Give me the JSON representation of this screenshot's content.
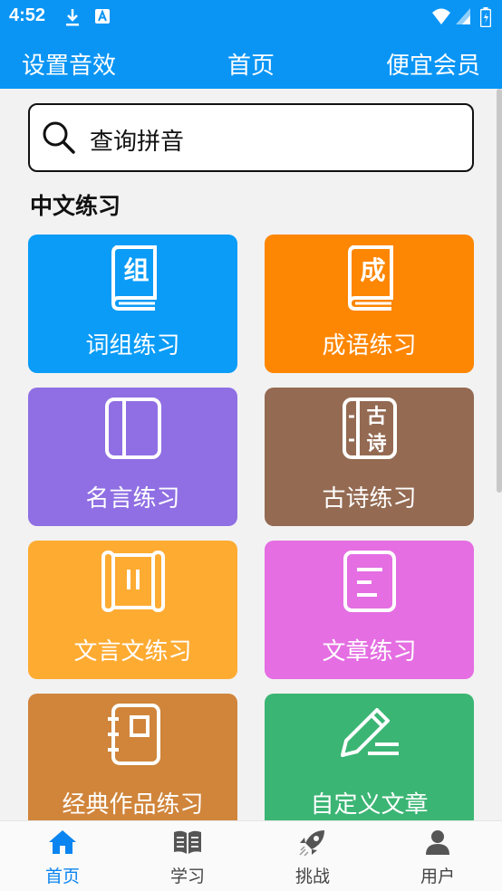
{
  "status_bar": {
    "time": "4:52",
    "icons": [
      "download-icon",
      "font-app-icon",
      "wifi-icon",
      "signal-icon",
      "battery-icon"
    ]
  },
  "app_bar": {
    "left_label": "设置音效",
    "title": "首页",
    "right_label": "便宜会员"
  },
  "search": {
    "placeholder": "查询拼音",
    "icon": "search-icon"
  },
  "section_title": "中文练习",
  "cards": [
    {
      "label": "词组练习",
      "glyph": "组",
      "icon": "book-icon",
      "color": "#0a9cf7"
    },
    {
      "label": "成语练习",
      "glyph": "成",
      "icon": "book-icon",
      "color": "#fd8602"
    },
    {
      "label": "名言练习",
      "glyph": "",
      "icon": "panel-book-icon",
      "color": "#8f6fe3"
    },
    {
      "label": "古诗练习",
      "glyph_top": "古",
      "glyph_bottom": "诗",
      "icon": "poem-book-icon",
      "color": "#946a52"
    },
    {
      "label": "文言文练习",
      "glyph": "",
      "icon": "scroll-icon",
      "color": "#feab32"
    },
    {
      "label": "文章练习",
      "glyph": "",
      "icon": "document-icon",
      "color": "#e46ee2"
    },
    {
      "label": "经典作品练习",
      "glyph": "",
      "icon": "notebook-icon",
      "color": "#d0853b"
    },
    {
      "label": "自定义文章",
      "glyph": "",
      "icon": "pencil-icon",
      "color": "#3bb574"
    }
  ],
  "bottom_nav": [
    {
      "label": "首页",
      "icon": "home-icon",
      "active": true
    },
    {
      "label": "学习",
      "icon": "open-book-icon",
      "active": false
    },
    {
      "label": "挑战",
      "icon": "rocket-icon",
      "active": false
    },
    {
      "label": "用户",
      "icon": "user-icon",
      "active": false
    }
  ],
  "colors": {
    "primary": "#0a95f5",
    "nav_active": "#0a84f0",
    "background": "#f2f2f2"
  }
}
